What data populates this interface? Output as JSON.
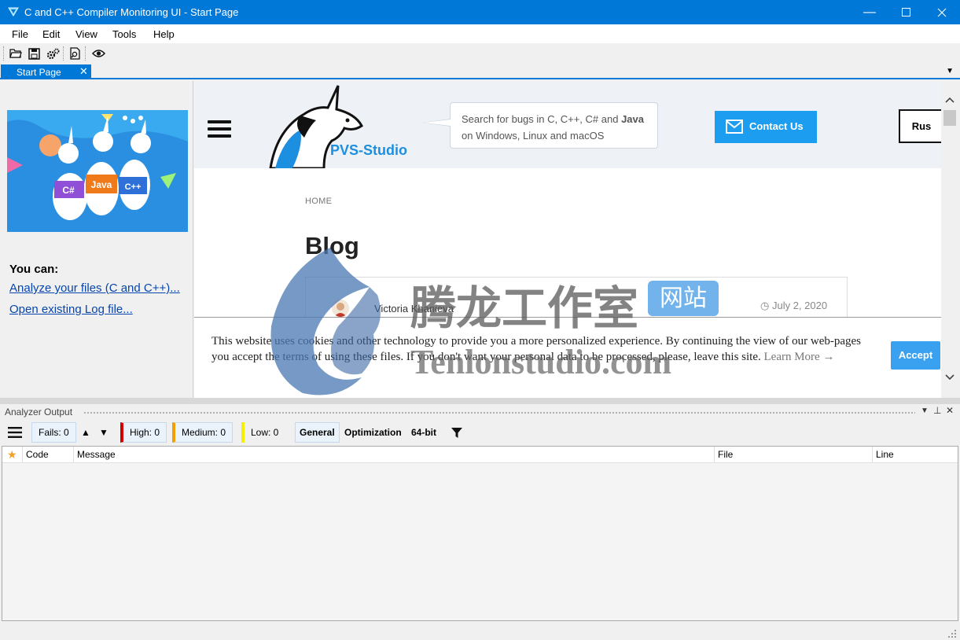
{
  "window": {
    "title": "C and C++ Compiler Monitoring UI - Start Page",
    "accent": "#0078d7",
    "controls": [
      "minimize-icon",
      "maximize-icon",
      "close-icon"
    ]
  },
  "menubar": {
    "items": [
      "File",
      "Edit",
      "View",
      "Tools",
      "Help"
    ]
  },
  "toolbar": {
    "icons": [
      "open-folder-icon",
      "save-icon",
      "settings-icon",
      "search-log-icon",
      "eye-icon"
    ]
  },
  "tabs": [
    {
      "label": "Start Page",
      "active": true
    }
  ],
  "left_panel": {
    "hero_labels": [
      "C#",
      "Java",
      "C++"
    ],
    "heading": "You can:",
    "links": [
      "Analyze your files (C and C++)...",
      "Open existing Log file..."
    ]
  },
  "web": {
    "logo_text": "PVS-Studio",
    "tagline_line1": "Search for bugs in C, C++, C# and ",
    "tagline_bold": "Java",
    "tagline_line2": "on Windows, Linux and macOS",
    "contact_label": "Contact Us",
    "rus_label": "Rus",
    "breadcrumb": "HOME",
    "blog_title": "Blog",
    "post": {
      "author": "Victoria Khanieva",
      "date": "July 2, 2020"
    },
    "cookie": {
      "text": "This website uses cookies and other technology to provide you a more personalized experience. By continuing the view of our web-pages you accept the terms of using these files. If you don't want your personal data to be processed, please, leave this site.",
      "learn_more": "Learn More",
      "arrow": "→",
      "accept_label": "Accept"
    }
  },
  "watermark": {
    "cn_text": "腾龙工作室",
    "badge": "网站",
    "url": "Tenlonstudio.com"
  },
  "analyzer": {
    "title": "Analyzer Output",
    "fails": "Fails: 0",
    "high": "High: 0",
    "medium": "Medium: 0",
    "low": "Low: 0",
    "general": "General",
    "optimization": "Optimization",
    "bit64": "64-bit",
    "colors": {
      "high": "#cc0000",
      "medium": "#f0a000",
      "low": "#f4f000"
    },
    "columns": [
      "Code",
      "Message",
      "File",
      "Line"
    ]
  }
}
